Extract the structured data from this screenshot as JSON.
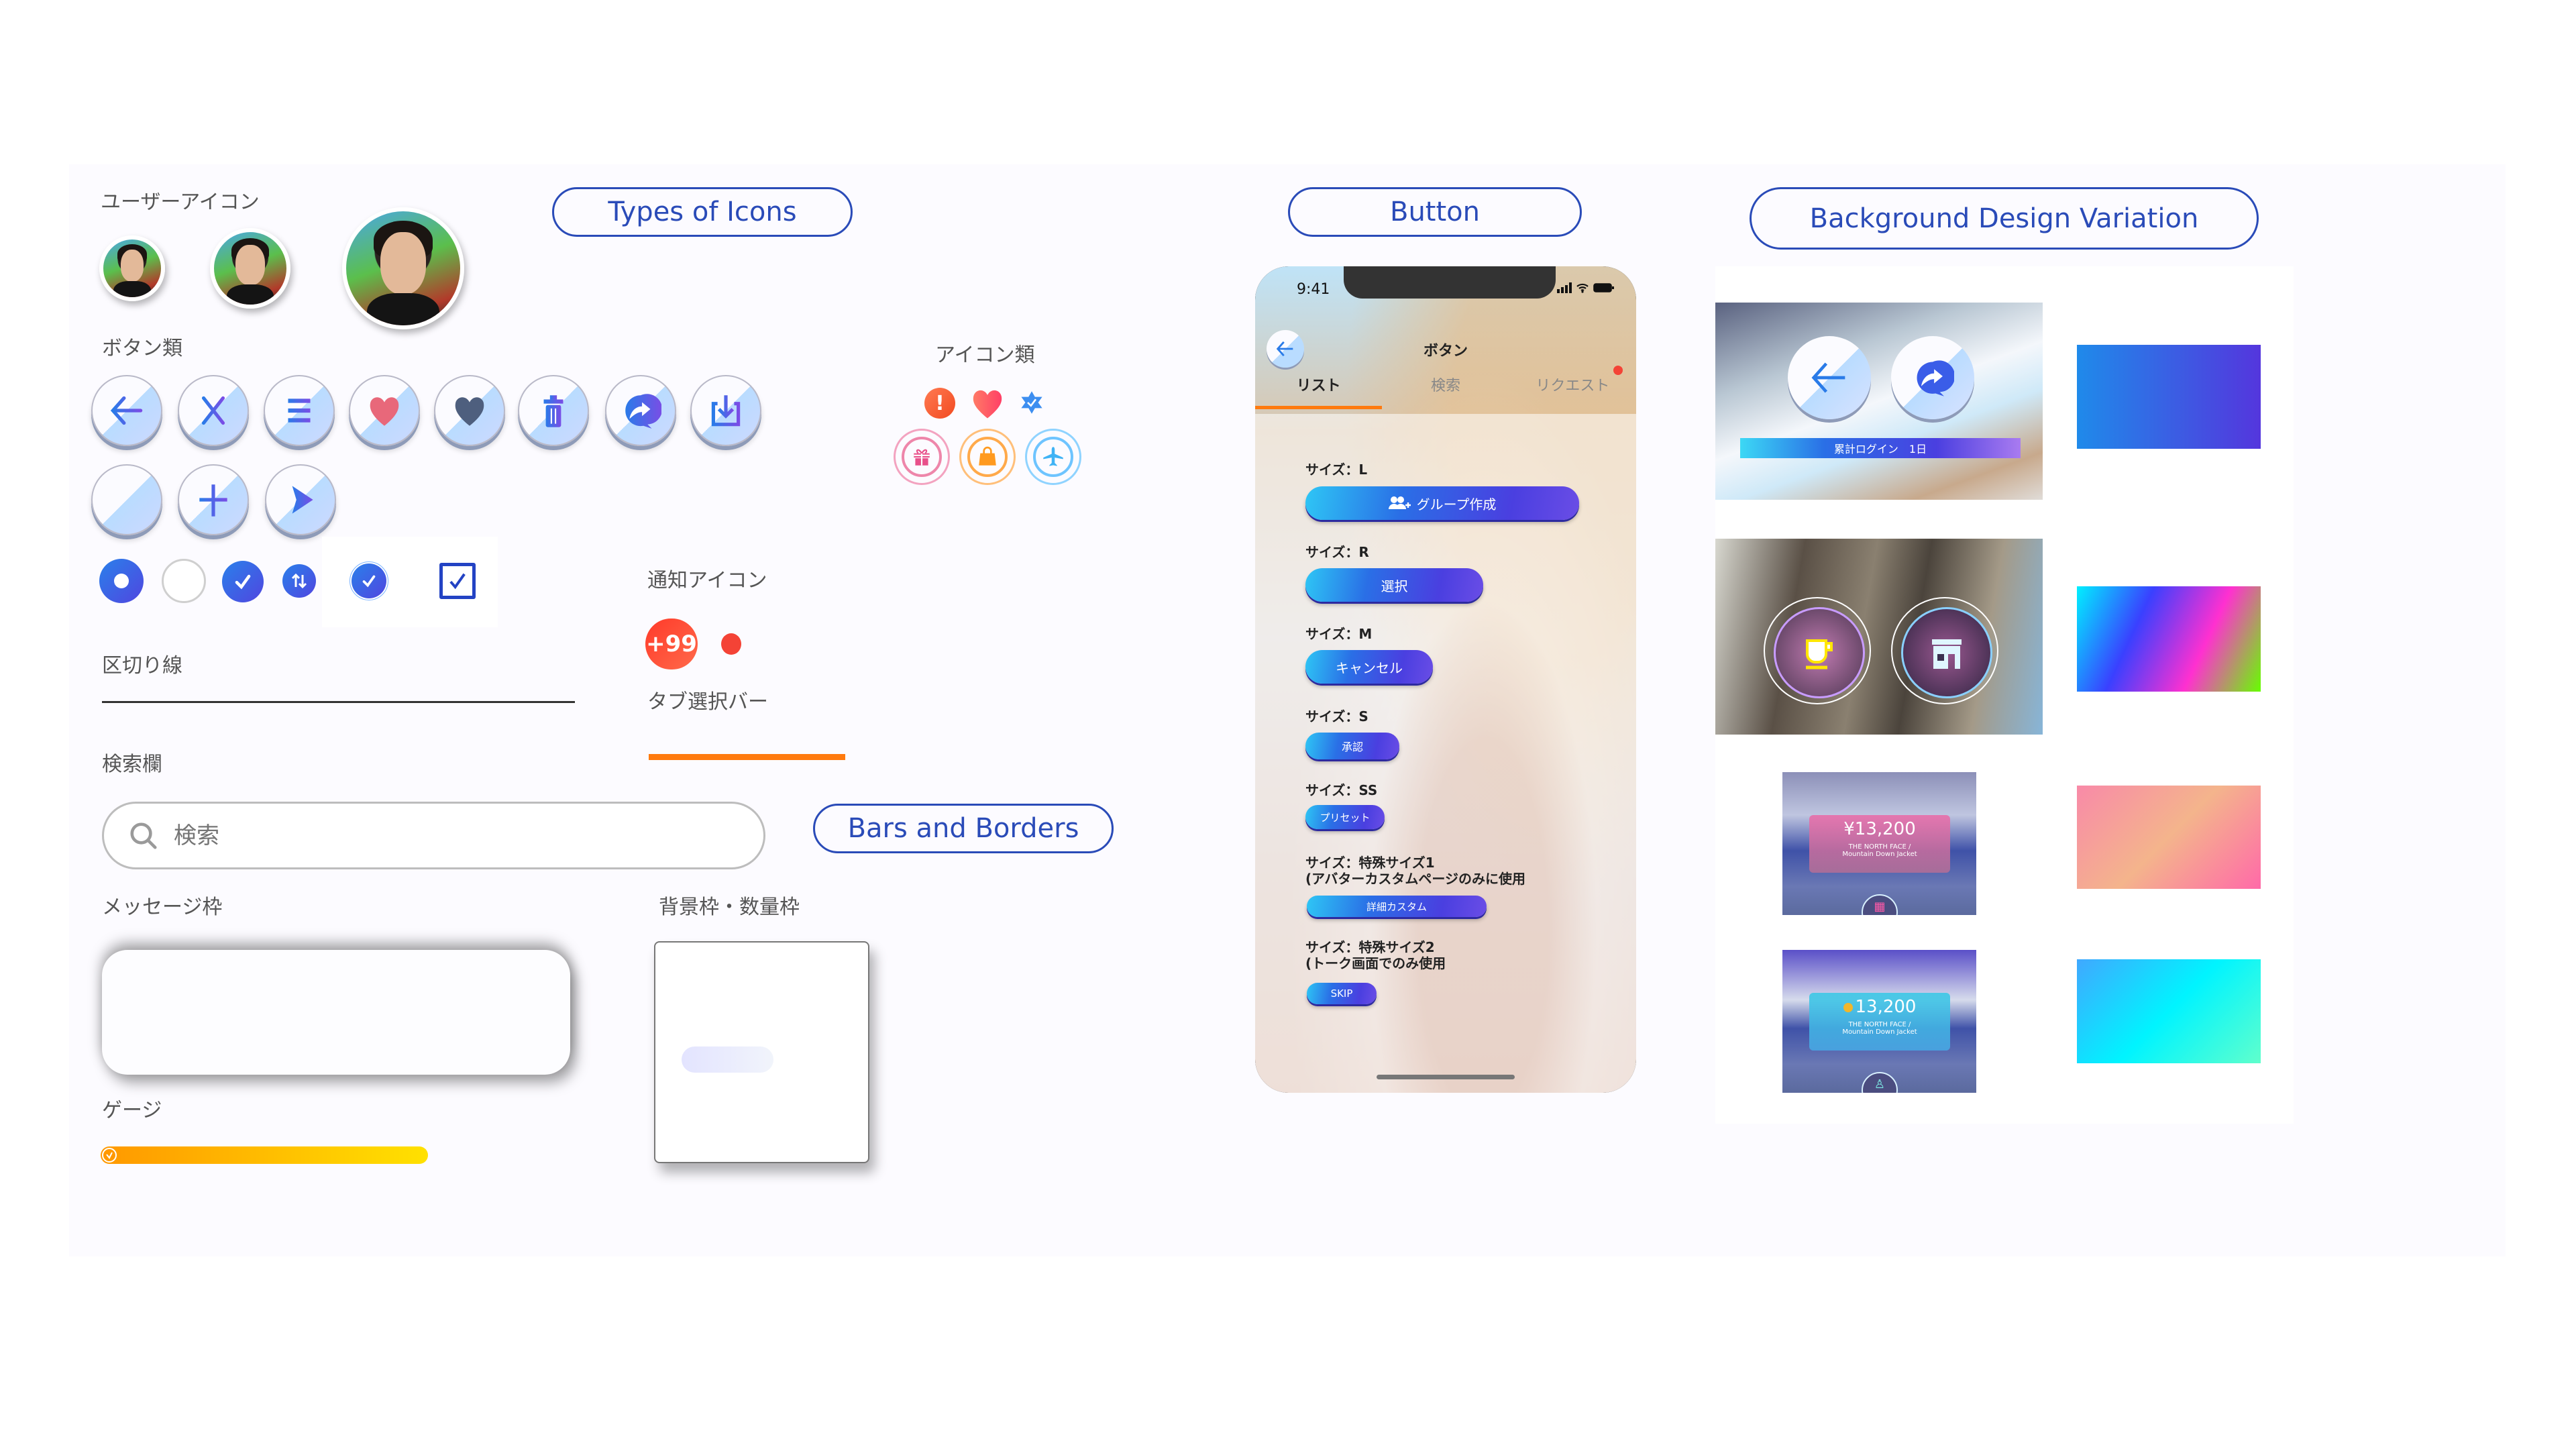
{
  "sections": {
    "types_of_icons": "Types of Icons",
    "button": "Button",
    "bars_and_borders": "Bars and Borders",
    "background_design_variation": "Background  Design Variation"
  },
  "labels": {
    "user_icon": "ユーザーアイコン",
    "buttons": "ボタン類",
    "icons": "アイコン類",
    "notification_icon": "通知アイコン",
    "divider": "区切り線",
    "tab_bar": "タブ選択バー",
    "search_field": "検索欄",
    "message_frame": "メッセージ枠",
    "background_quantity_frame": "背景枠・数量枠",
    "gauge": "ゲージ"
  },
  "user_icons": [
    {
      "size": "small",
      "icon": "user-avatar"
    },
    {
      "size": "medium",
      "icon": "user-avatar"
    },
    {
      "size": "large",
      "icon": "user-avatar"
    }
  ],
  "round_buttons": [
    {
      "icon": "arrow-left-icon"
    },
    {
      "icon": "close-icon"
    },
    {
      "icon": "menu-icon"
    },
    {
      "icon": "heart-red-icon",
      "color": "#e8687a"
    },
    {
      "icon": "heart-dark-icon",
      "color": "#4e5f7e"
    },
    {
      "icon": "trash-icon"
    },
    {
      "icon": "chat-share-icon"
    },
    {
      "icon": "download-tray-icon"
    },
    {
      "icon": "minus-icon"
    },
    {
      "icon": "plus-icon"
    },
    {
      "icon": "play-icon"
    }
  ],
  "selection_controls": [
    {
      "type": "radio",
      "state": "selected"
    },
    {
      "type": "radio",
      "state": "unselected"
    },
    {
      "type": "check-circle",
      "state": "checked"
    },
    {
      "type": "swap-circle",
      "icon": "swap-vertical-icon"
    },
    {
      "type": "check-circle-small",
      "state": "checked"
    },
    {
      "type": "checkbox",
      "state": "checked"
    }
  ],
  "icon_types": {
    "row1": [
      {
        "icon": "alert-icon",
        "color": "#ff5a36"
      },
      {
        "icon": "heart-icon",
        "color": "#ff4f6a"
      },
      {
        "icon": "verified-star-icon",
        "color": "#3d8ef0"
      }
    ],
    "row2": [
      {
        "icon": "gift-icon",
        "color": "#ee5b8f"
      },
      {
        "icon": "shopping-bag-icon",
        "color": "#ff9a1f"
      },
      {
        "icon": "airplane-icon",
        "color": "#3fb3f5"
      }
    ]
  },
  "notification": {
    "badge_count": "+99",
    "badge_color": "#f4402c"
  },
  "tab_bar_color": "#ff7a0e",
  "search": {
    "placeholder": "検索"
  },
  "gauge": {
    "value_fraction": 1.0,
    "colors": [
      "#ff9800",
      "#ffe100"
    ]
  },
  "phone": {
    "time": "9:41",
    "title": "ボタン",
    "tabs": [
      {
        "label": "リスト",
        "active": true
      },
      {
        "label": "検索",
        "active": false
      },
      {
        "label": "リクエスト",
        "active": false,
        "badge": true
      }
    ],
    "button_groups": [
      {
        "label": "サイズ：L",
        "button": "グループ作成",
        "icon": "add-group-icon"
      },
      {
        "label": "サイズ：R",
        "button": "選択"
      },
      {
        "label": "サイズ：M",
        "button": "キャンセル"
      },
      {
        "label": "サイズ：S",
        "button": "承認"
      },
      {
        "label": "サイズ：SS",
        "button": "プリセット"
      },
      {
        "label": "サイズ：特殊サイズ1",
        "sublabel": "(アバターカスタムページのみに使用",
        "button": "詳細カスタム"
      },
      {
        "label": "サイズ：特殊サイズ2",
        "sublabel": "(トーク画面でのみ使用",
        "button": "SKIP"
      }
    ]
  },
  "backgrounds": {
    "login_banner": "累計ログイン　1日",
    "product1": {
      "price": "¥13,200",
      "brand": "THE NORTH FACE /",
      "name": "Mountain Down Jacket"
    },
    "product2": {
      "price": "13,200",
      "brand": "THE NORTH FACE /",
      "name": "Mountain Down Jacket"
    },
    "gradients": [
      {
        "name": "blue-purple",
        "colors": [
          "#1f8aea",
          "#5436dd"
        ]
      },
      {
        "name": "rainbow",
        "colors": [
          "#00f0ff",
          "#3a40ff",
          "#ff30d0",
          "#66ff00"
        ]
      },
      {
        "name": "peach-pink",
        "colors": [
          "#f88aa8",
          "#f4b48c",
          "#ff6aa8"
        ]
      },
      {
        "name": "cyan",
        "colors": [
          "#40a8ff",
          "#00f4ff",
          "#60ffcc"
        ]
      }
    ]
  }
}
